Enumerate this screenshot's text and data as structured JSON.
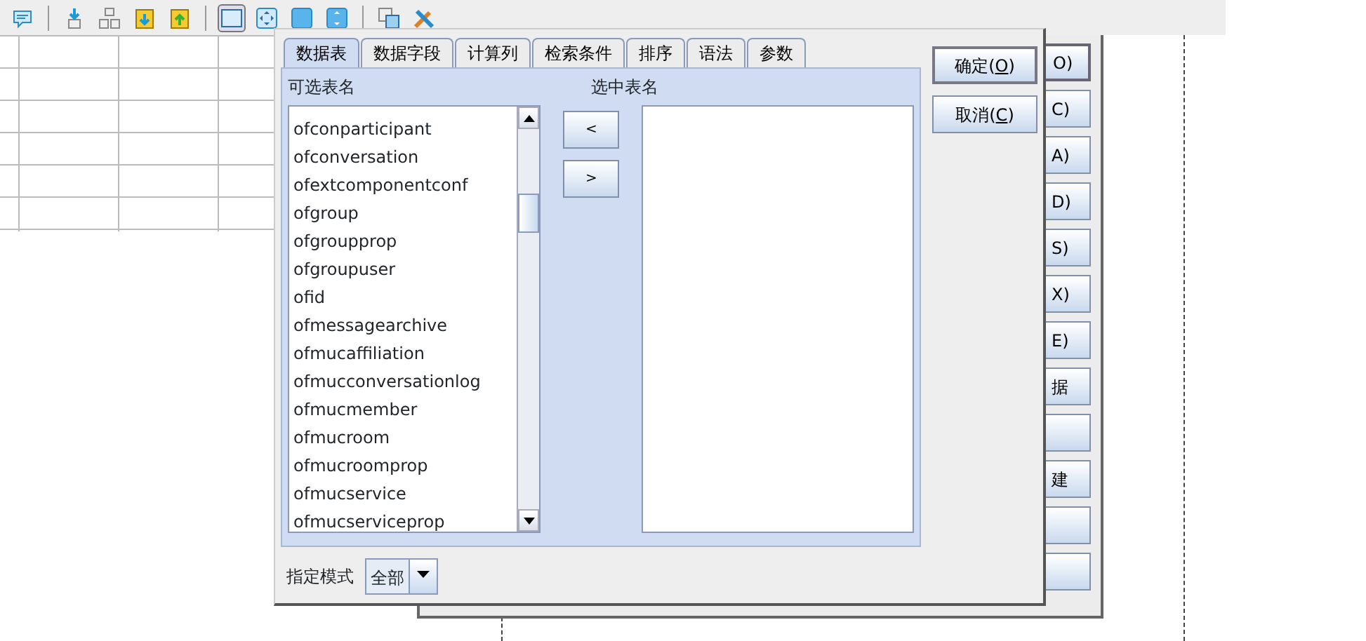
{
  "toolbar": {
    "items": [
      {
        "kind": "comment",
        "selected": false
      },
      {
        "kind": "sep"
      },
      {
        "kind": "import",
        "selected": false
      },
      {
        "kind": "tree",
        "selected": false
      },
      {
        "kind": "clipdown",
        "selected": false
      },
      {
        "kind": "clipup",
        "selected": false
      },
      {
        "kind": "sep"
      },
      {
        "kind": "window",
        "selected": true
      },
      {
        "kind": "fit",
        "selected": false
      },
      {
        "kind": "square",
        "selected": false
      },
      {
        "kind": "expand",
        "selected": false
      },
      {
        "kind": "sep"
      },
      {
        "kind": "copy",
        "selected": false
      },
      {
        "kind": "tools",
        "selected": false
      }
    ]
  },
  "back_dialog": {
    "buttons": [
      {
        "label": "O)",
        "default": true
      },
      {
        "label": "C)",
        "default": false
      },
      {
        "label": "A)",
        "default": false
      },
      {
        "label": "D)",
        "default": false
      },
      {
        "label": "S)",
        "default": false
      },
      {
        "label": "X)",
        "default": false
      },
      {
        "label": "E)",
        "default": false
      },
      {
        "label": "据",
        "default": false
      },
      {
        "default": false
      },
      {
        "label": "建",
        "default": false
      },
      {
        "default": false
      },
      {
        "default": false
      }
    ]
  },
  "dialog": {
    "tabs": [
      {
        "label": "数据表",
        "selected": true
      },
      {
        "label": "数据字段",
        "selected": false
      },
      {
        "label": "计算列",
        "selected": false
      },
      {
        "label": "检索条件",
        "selected": false
      },
      {
        "label": "排序",
        "selected": false
      },
      {
        "label": "语法",
        "selected": false
      },
      {
        "label": "参数",
        "selected": false
      }
    ],
    "available_label": "可选表名",
    "selected_label": "选中表名",
    "available_tables": [
      "ofconparticipant",
      "ofconversation",
      "ofextcomponentconf",
      "ofgroup",
      "ofgroupprop",
      "ofgroupuser",
      "ofid",
      "ofmessagearchive",
      "ofmucaffiliation",
      "ofmucconversationlog",
      "ofmucmember",
      "ofmucroom",
      "ofmucroomprop",
      "ofmucservice",
      "ofmucserviceprop"
    ],
    "move_buttons": [
      "<",
      ">"
    ],
    "mode_label": "指定模式",
    "mode_value": "全部",
    "buttons": [
      {
        "label": "确定(",
        "mnemonic": "O",
        "label_end": ")",
        "default": true
      },
      {
        "label": "取消(",
        "mnemonic": "C",
        "label_end": ")",
        "default": false
      }
    ]
  }
}
